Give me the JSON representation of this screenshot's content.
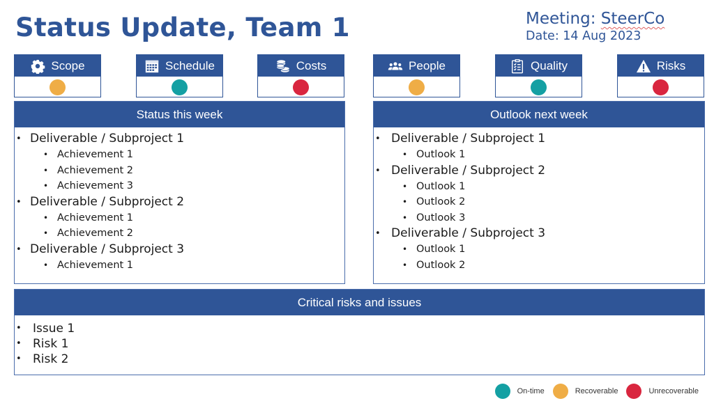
{
  "header": {
    "title": "Status Update, Team 1",
    "meeting_label": "Meeting: ",
    "meeting_name": "SteerCo",
    "date": "Date: 14 Aug 2023"
  },
  "colors": {
    "brand": "#2f5597",
    "on_time": "#14a0a3",
    "recoverable": "#efad46",
    "unrecoverable": "#d9263f"
  },
  "status_tiles": [
    {
      "label": "Scope",
      "icon": "gear-icon",
      "status": "recoverable"
    },
    {
      "label": "Schedule",
      "icon": "calendar-icon",
      "status": "on_time"
    },
    {
      "label": "Costs",
      "icon": "coins-icon",
      "status": "unrecoverable"
    },
    {
      "label": "People",
      "icon": "people-icon",
      "status": "recoverable"
    },
    {
      "label": "Quality",
      "icon": "checklist-icon",
      "status": "on_time"
    },
    {
      "label": "Risks",
      "icon": "warning-icon",
      "status": "unrecoverable"
    }
  ],
  "status_this_week": {
    "title": "Status this week",
    "items": [
      {
        "label": "Deliverable / Subproject 1",
        "children": [
          "Achievement 1",
          "Achievement 2",
          "Achievement 3"
        ]
      },
      {
        "label": "Deliverable / Subproject 2",
        "children": [
          "Achievement 1",
          "Achievement 2"
        ]
      },
      {
        "label": "Deliverable / Subproject 3",
        "children": [
          "Achievement 1"
        ]
      }
    ]
  },
  "outlook_next_week": {
    "title": "Outlook next week",
    "items": [
      {
        "label": "Deliverable / Subproject 1",
        "children": [
          "Outlook 1"
        ]
      },
      {
        "label": "Deliverable / Subproject 2",
        "children": [
          "Outlook 1",
          "Outlook 2",
          "Outlook 3"
        ]
      },
      {
        "label": "Deliverable / Subproject 3",
        "children": [
          "Outlook 1",
          "Outlook 2"
        ]
      }
    ]
  },
  "critical_risks": {
    "title": "Critical risks and issues",
    "items": [
      "Issue 1",
      "Risk 1",
      "Risk 2"
    ]
  },
  "legend": [
    {
      "label": "On-time",
      "status": "on_time"
    },
    {
      "label": "Recoverable",
      "status": "recoverable"
    },
    {
      "label": "Unrecoverable",
      "status": "unrecoverable"
    }
  ]
}
